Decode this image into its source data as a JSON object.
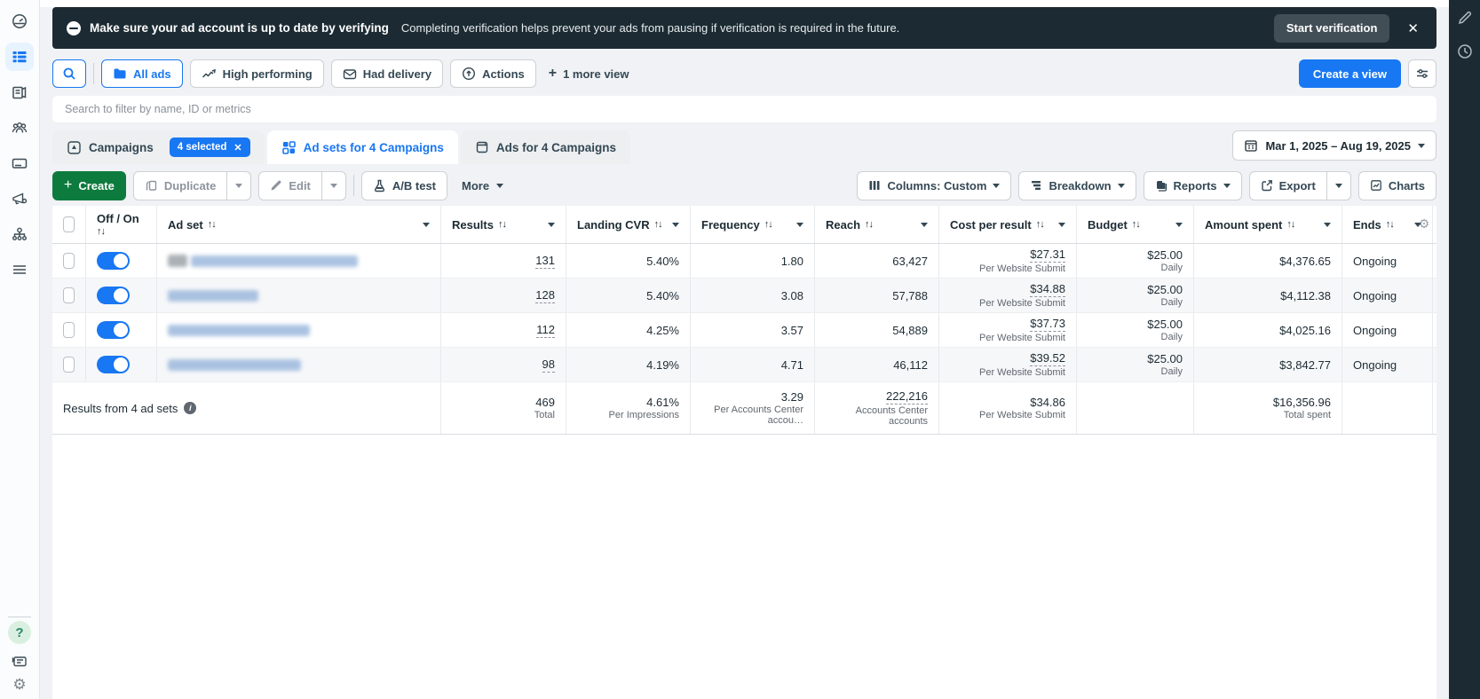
{
  "banner": {
    "bold_text": "Make sure your ad account is up to date by verifying",
    "text": "Completing verification helps prevent your ads from pausing if verification is required in the future.",
    "button": "Start verification"
  },
  "views_bar": {
    "views": [
      {
        "label": "All ads"
      },
      {
        "label": "High performing"
      },
      {
        "label": "Had delivery"
      },
      {
        "label": "Actions"
      }
    ],
    "more_view": "1 more view",
    "create_view": "Create a view"
  },
  "search": {
    "placeholder": "Search to filter by name, ID or metrics"
  },
  "tabs": [
    {
      "label": "Campaigns",
      "badge": "4 selected"
    },
    {
      "label": "Ad sets for 4 Campaigns"
    },
    {
      "label": "Ads for 4 Campaigns"
    }
  ],
  "date_range": "Mar 1, 2025 – Aug 19, 2025",
  "toolbar": {
    "create": "Create",
    "duplicate": "Duplicate",
    "edit": "Edit",
    "ab_test": "A/B test",
    "more": "More",
    "columns": "Columns: Custom",
    "breakdown": "Breakdown",
    "reports": "Reports",
    "export": "Export",
    "charts": "Charts"
  },
  "table": {
    "headers": {
      "off_on": "Off / On",
      "ad_set": "Ad set",
      "results": "Results",
      "landing_cvr": "Landing CVR",
      "frequency": "Frequency",
      "reach": "Reach",
      "cost_per_result": "Cost per result",
      "budget": "Budget",
      "amount_spent": "Amount spent",
      "ends": "Ends"
    },
    "rows": [
      {
        "results": "131",
        "landing_cvr": "5.40%",
        "frequency": "1.80",
        "reach": "63,427",
        "cost_per_result": "$27.31",
        "cost_sub": "Per Website Submit",
        "budget": "$25.00",
        "budget_sub": "Daily",
        "amount_spent": "$4,376.65",
        "ends": "Ongoing"
      },
      {
        "results": "128",
        "landing_cvr": "5.40%",
        "frequency": "3.08",
        "reach": "57,788",
        "cost_per_result": "$34.88",
        "cost_sub": "Per Website Submit",
        "budget": "$25.00",
        "budget_sub": "Daily",
        "amount_spent": "$4,112.38",
        "ends": "Ongoing"
      },
      {
        "results": "112",
        "landing_cvr": "4.25%",
        "frequency": "3.57",
        "reach": "54,889",
        "cost_per_result": "$37.73",
        "cost_sub": "Per Website Submit",
        "budget": "$25.00",
        "budget_sub": "Daily",
        "amount_spent": "$4,025.16",
        "ends": "Ongoing"
      },
      {
        "results": "98",
        "landing_cvr": "4.19%",
        "frequency": "4.71",
        "reach": "46,112",
        "cost_per_result": "$39.52",
        "cost_sub": "Per Website Submit",
        "budget": "$25.00",
        "budget_sub": "Daily",
        "amount_spent": "$3,842.77",
        "ends": "Ongoing"
      }
    ],
    "totals": {
      "label": "Results from 4 ad sets",
      "results": "469",
      "results_sub": "Total",
      "landing_cvr": "4.61%",
      "landing_cvr_sub": "Per Impressions",
      "frequency": "3.29",
      "frequency_sub": "Per Accounts Center accou…",
      "reach": "222,216",
      "reach_sub": "Accounts Center accounts",
      "cost_per_result": "$34.86",
      "cost_sub": "Per Website Submit",
      "amount_spent": "$16,356.96",
      "amount_spent_sub": "Total spent"
    }
  },
  "icons": {
    "sort": "↑↓",
    "close": "✕",
    "plus": "+",
    "info": "i",
    "gear": "⚙",
    "help": "?"
  },
  "colors": {
    "accent": "#1877f2",
    "green": "#0e7b3e",
    "banner_bg": "#1c2b33"
  }
}
